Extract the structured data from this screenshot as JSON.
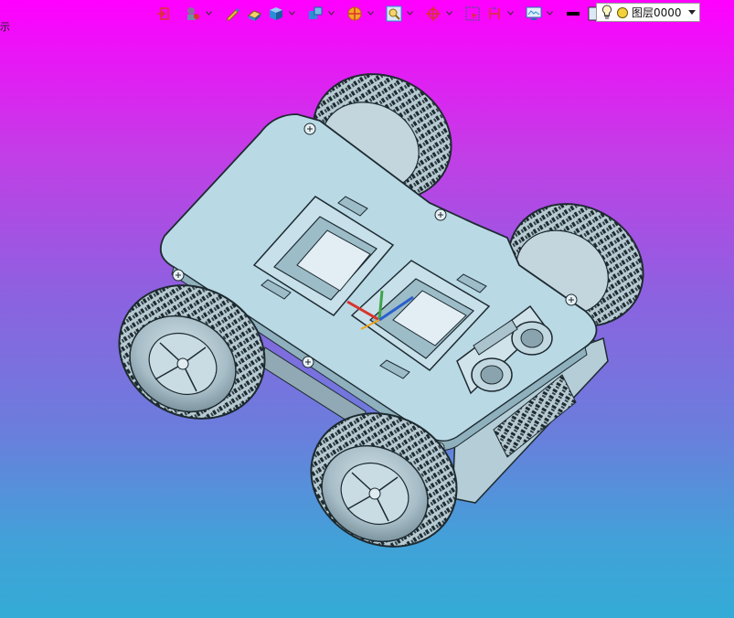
{
  "viewport": {
    "left_hint_text": "示",
    "gradient": {
      "top": "#ff00ff",
      "bottom": "#33abd6"
    }
  },
  "toolbar": {
    "items": [
      {
        "icon": "exit-sketch-icon"
      },
      {
        "icon": "render-style-icon",
        "has_dropdown": true
      },
      {
        "icon": "pen-icon"
      },
      {
        "icon": "eraser-icon"
      },
      {
        "icon": "shaded-cube-icon",
        "has_dropdown": true
      },
      {
        "icon": "view-cube-icon",
        "has_dropdown": true
      },
      {
        "icon": "section-view-icon",
        "has_dropdown": true
      },
      {
        "icon": "zoom-fit-icon",
        "has_dropdown": true
      },
      {
        "icon": "snap-point-icon",
        "has_dropdown": true
      },
      {
        "icon": "select-box-icon"
      },
      {
        "icon": "bracket-icon",
        "has_dropdown": true
      },
      {
        "icon": "display-settings-icon",
        "has_dropdown": true
      },
      {
        "icon": "line-width-icon"
      },
      {
        "icon": "color-swatch-icon"
      },
      {
        "icon": "layer-stack-icon",
        "has_dropdown": true
      }
    ],
    "colors": {
      "accent_blue": "#2a8fd6",
      "accent_orange": "#f0a21b",
      "accent_red": "#d9342b"
    }
  },
  "layer_selector": {
    "value": "图层0000",
    "bulb_icon": "light-bulb-icon",
    "sun_icon": "layer-color-icon",
    "caret_icon": "chevron-down-icon"
  },
  "model": {
    "plate_color": "#b9d9e5",
    "tire_color": "#9fb4bf",
    "edge_color": "#1d2a30"
  }
}
